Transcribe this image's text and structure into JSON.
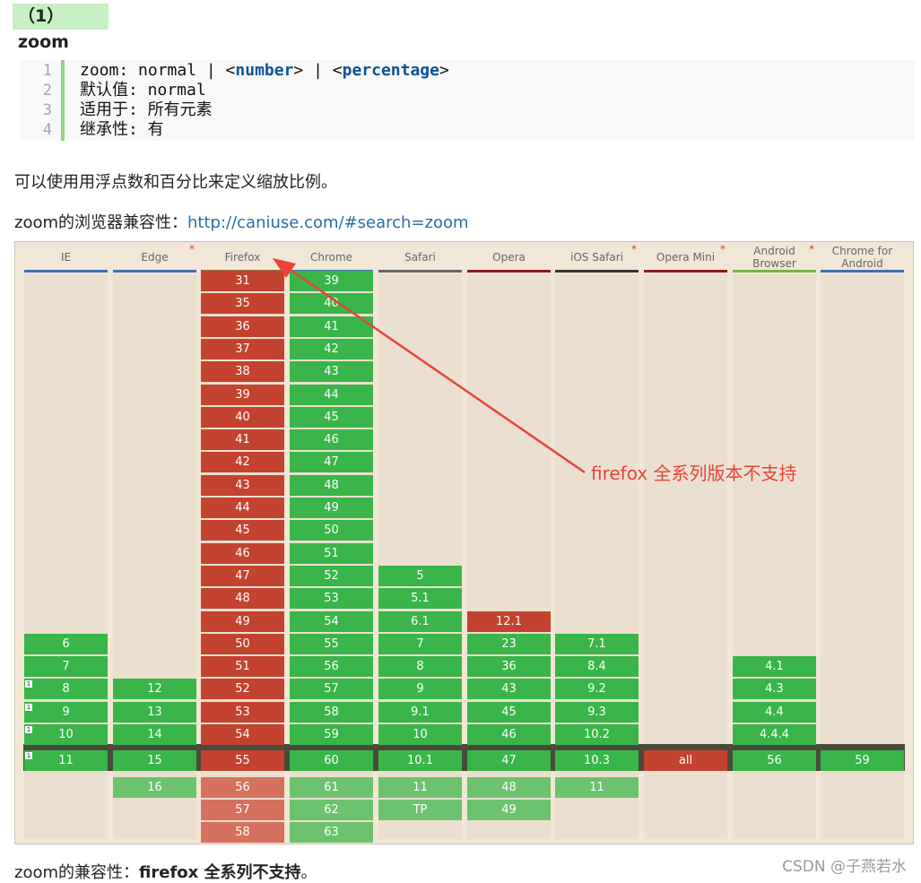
{
  "heading": "（1）zoom",
  "code": {
    "line_numbers": [
      "1",
      "2",
      "3",
      "4"
    ],
    "line1_a": "zoom: normal | <",
    "line1_b": "number",
    "line1_c": "> | <",
    "line1_d": "percentage",
    "line1_e": ">",
    "line2": "默认值: normal",
    "line3": "适用于: 所有元素",
    "line4": "继承性: 有"
  },
  "para1": "可以使用用浮点数和百分比来定义缩放比例。",
  "para2_label": "zoom的浏览器兼容性：",
  "para2_link": "http://caniuse.com/#search=zoom",
  "table": {
    "columns": [
      {
        "name": "IE",
        "starred": false,
        "bar": "#3d6fb3"
      },
      {
        "name": "Edge",
        "starred": true,
        "bar": "#3d6fb3"
      },
      {
        "name": "Firefox",
        "starred": false,
        "bar": "#8a6d3b"
      },
      {
        "name": "Chrome",
        "starred": false,
        "bar": "#3d6fb3"
      },
      {
        "name": "Safari",
        "starred": false,
        "bar": "#666666"
      },
      {
        "name": "Opera",
        "starred": false,
        "bar": "#8b1a1a"
      },
      {
        "name": "iOS Safari",
        "starred": true,
        "bar": "#333333"
      },
      {
        "name": "Opera Mini",
        "starred": true,
        "bar": "#8b1a1a"
      },
      {
        "name": "Android Browser",
        "starred": true,
        "bar": "#7cb342"
      },
      {
        "name": "Chrome for Android",
        "starred": false,
        "bar": "#3d6fb3"
      }
    ],
    "star": "*",
    "note_mark": "1",
    "status_colors": {
      "supported": "#39b54a",
      "unsupported": "#c44230"
    },
    "cells": [
      {
        "col": 0,
        "row": 16,
        "v": "6",
        "s": "y"
      },
      {
        "col": 0,
        "row": 17,
        "v": "7",
        "s": "y"
      },
      {
        "col": 0,
        "row": 18,
        "v": "8",
        "s": "y",
        "note": true
      },
      {
        "col": 0,
        "row": 19,
        "v": "9",
        "s": "y",
        "note": true
      },
      {
        "col": 0,
        "row": 20,
        "v": "10",
        "s": "y",
        "note": true
      },
      {
        "col": 0,
        "row": 21,
        "v": "11",
        "s": "y",
        "note": true
      },
      {
        "col": 1,
        "row": 18,
        "v": "12",
        "s": "y"
      },
      {
        "col": 1,
        "row": 19,
        "v": "13",
        "s": "y"
      },
      {
        "col": 1,
        "row": 20,
        "v": "14",
        "s": "y"
      },
      {
        "col": 1,
        "row": 21,
        "v": "15",
        "s": "y"
      },
      {
        "col": 1,
        "row": 22,
        "v": "16",
        "s": "yf"
      },
      {
        "col": 2,
        "row": 0,
        "v": "31",
        "s": "n"
      },
      {
        "col": 2,
        "row": 1,
        "v": "35",
        "s": "n"
      },
      {
        "col": 2,
        "row": 2,
        "v": "36",
        "s": "n"
      },
      {
        "col": 2,
        "row": 3,
        "v": "37",
        "s": "n"
      },
      {
        "col": 2,
        "row": 4,
        "v": "38",
        "s": "n"
      },
      {
        "col": 2,
        "row": 5,
        "v": "39",
        "s": "n"
      },
      {
        "col": 2,
        "row": 6,
        "v": "40",
        "s": "n"
      },
      {
        "col": 2,
        "row": 7,
        "v": "41",
        "s": "n"
      },
      {
        "col": 2,
        "row": 8,
        "v": "42",
        "s": "n"
      },
      {
        "col": 2,
        "row": 9,
        "v": "43",
        "s": "n"
      },
      {
        "col": 2,
        "row": 10,
        "v": "44",
        "s": "n"
      },
      {
        "col": 2,
        "row": 11,
        "v": "45",
        "s": "n"
      },
      {
        "col": 2,
        "row": 12,
        "v": "46",
        "s": "n"
      },
      {
        "col": 2,
        "row": 13,
        "v": "47",
        "s": "n"
      },
      {
        "col": 2,
        "row": 14,
        "v": "48",
        "s": "n"
      },
      {
        "col": 2,
        "row": 15,
        "v": "49",
        "s": "n"
      },
      {
        "col": 2,
        "row": 16,
        "v": "50",
        "s": "n"
      },
      {
        "col": 2,
        "row": 17,
        "v": "51",
        "s": "n"
      },
      {
        "col": 2,
        "row": 18,
        "v": "52",
        "s": "n"
      },
      {
        "col": 2,
        "row": 19,
        "v": "53",
        "s": "n"
      },
      {
        "col": 2,
        "row": 20,
        "v": "54",
        "s": "n"
      },
      {
        "col": 2,
        "row": 21,
        "v": "55",
        "s": "n"
      },
      {
        "col": 2,
        "row": 22,
        "v": "56",
        "s": "nf"
      },
      {
        "col": 2,
        "row": 23,
        "v": "57",
        "s": "nf"
      },
      {
        "col": 2,
        "row": 24,
        "v": "58",
        "s": "nf"
      },
      {
        "col": 3,
        "row": 0,
        "v": "39",
        "s": "y"
      },
      {
        "col": 3,
        "row": 1,
        "v": "40",
        "s": "y"
      },
      {
        "col": 3,
        "row": 2,
        "v": "41",
        "s": "y"
      },
      {
        "col": 3,
        "row": 3,
        "v": "42",
        "s": "y"
      },
      {
        "col": 3,
        "row": 4,
        "v": "43",
        "s": "y"
      },
      {
        "col": 3,
        "row": 5,
        "v": "44",
        "s": "y"
      },
      {
        "col": 3,
        "row": 6,
        "v": "45",
        "s": "y"
      },
      {
        "col": 3,
        "row": 7,
        "v": "46",
        "s": "y"
      },
      {
        "col": 3,
        "row": 8,
        "v": "47",
        "s": "y"
      },
      {
        "col": 3,
        "row": 9,
        "v": "48",
        "s": "y"
      },
      {
        "col": 3,
        "row": 10,
        "v": "49",
        "s": "y"
      },
      {
        "col": 3,
        "row": 11,
        "v": "50",
        "s": "y"
      },
      {
        "col": 3,
        "row": 12,
        "v": "51",
        "s": "y"
      },
      {
        "col": 3,
        "row": 13,
        "v": "52",
        "s": "y"
      },
      {
        "col": 3,
        "row": 14,
        "v": "53",
        "s": "y"
      },
      {
        "col": 3,
        "row": 15,
        "v": "54",
        "s": "y"
      },
      {
        "col": 3,
        "row": 16,
        "v": "55",
        "s": "y"
      },
      {
        "col": 3,
        "row": 17,
        "v": "56",
        "s": "y"
      },
      {
        "col": 3,
        "row": 18,
        "v": "57",
        "s": "y"
      },
      {
        "col": 3,
        "row": 19,
        "v": "58",
        "s": "y"
      },
      {
        "col": 3,
        "row": 20,
        "v": "59",
        "s": "y"
      },
      {
        "col": 3,
        "row": 21,
        "v": "60",
        "s": "y"
      },
      {
        "col": 3,
        "row": 22,
        "v": "61",
        "s": "yf"
      },
      {
        "col": 3,
        "row": 23,
        "v": "62",
        "s": "yf"
      },
      {
        "col": 3,
        "row": 24,
        "v": "63",
        "s": "yf"
      },
      {
        "col": 4,
        "row": 13,
        "v": "5",
        "s": "y"
      },
      {
        "col": 4,
        "row": 14,
        "v": "5.1",
        "s": "y"
      },
      {
        "col": 4,
        "row": 15,
        "v": "6.1",
        "s": "y"
      },
      {
        "col": 4,
        "row": 16,
        "v": "7",
        "s": "y"
      },
      {
        "col": 4,
        "row": 17,
        "v": "8",
        "s": "y"
      },
      {
        "col": 4,
        "row": 18,
        "v": "9",
        "s": "y"
      },
      {
        "col": 4,
        "row": 19,
        "v": "9.1",
        "s": "y"
      },
      {
        "col": 4,
        "row": 20,
        "v": "10",
        "s": "y"
      },
      {
        "col": 4,
        "row": 21,
        "v": "10.1",
        "s": "y"
      },
      {
        "col": 4,
        "row": 22,
        "v": "11",
        "s": "yf"
      },
      {
        "col": 4,
        "row": 23,
        "v": "TP",
        "s": "yf"
      },
      {
        "col": 5,
        "row": 15,
        "v": "12.1",
        "s": "n"
      },
      {
        "col": 5,
        "row": 16,
        "v": "23",
        "s": "y"
      },
      {
        "col": 5,
        "row": 17,
        "v": "36",
        "s": "y"
      },
      {
        "col": 5,
        "row": 18,
        "v": "43",
        "s": "y"
      },
      {
        "col": 5,
        "row": 19,
        "v": "45",
        "s": "y"
      },
      {
        "col": 5,
        "row": 20,
        "v": "46",
        "s": "y"
      },
      {
        "col": 5,
        "row": 21,
        "v": "47",
        "s": "y"
      },
      {
        "col": 5,
        "row": 22,
        "v": "48",
        "s": "yf"
      },
      {
        "col": 5,
        "row": 23,
        "v": "49",
        "s": "yf"
      },
      {
        "col": 6,
        "row": 16,
        "v": "7.1",
        "s": "y"
      },
      {
        "col": 6,
        "row": 17,
        "v": "8.4",
        "s": "y"
      },
      {
        "col": 6,
        "row": 18,
        "v": "9.2",
        "s": "y"
      },
      {
        "col": 6,
        "row": 19,
        "v": "9.3",
        "s": "y"
      },
      {
        "col": 6,
        "row": 20,
        "v": "10.2",
        "s": "y"
      },
      {
        "col": 6,
        "row": 21,
        "v": "10.3",
        "s": "y"
      },
      {
        "col": 6,
        "row": 22,
        "v": "11",
        "s": "yf"
      },
      {
        "col": 7,
        "row": 21,
        "v": "all",
        "s": "n"
      },
      {
        "col": 8,
        "row": 17,
        "v": "4.1",
        "s": "y"
      },
      {
        "col": 8,
        "row": 18,
        "v": "4.3",
        "s": "y"
      },
      {
        "col": 8,
        "row": 19,
        "v": "4.4",
        "s": "y"
      },
      {
        "col": 8,
        "row": 20,
        "v": "4.4.4",
        "s": "y"
      },
      {
        "col": 8,
        "row": 21,
        "v": "56",
        "s": "y"
      },
      {
        "col": 9,
        "row": 21,
        "v": "59",
        "s": "y"
      }
    ]
  },
  "annotation": "firefox 全系列版本不支持",
  "annotation_color": "#e8423a",
  "para3_label": "zoom的兼容性：",
  "para3_bold": "firefox 全系列不支持",
  "para3_end": "。",
  "watermark": "CSDN @子燕若水"
}
